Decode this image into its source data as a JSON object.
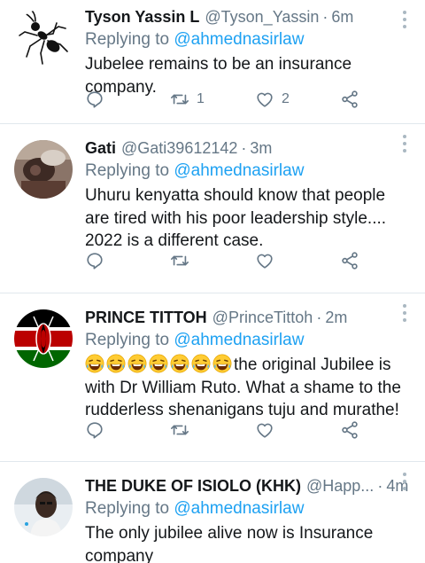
{
  "tweets": [
    {
      "name": "Tyson Yassin L",
      "handle": "@Tyson_Yassin",
      "time": "6m",
      "replying_prefix": "Replying to",
      "replying_to": "@ahmednasirlaw",
      "text": "Jubelee remains to be an insurance company.",
      "retweets": "1",
      "likes": "2",
      "avatar": "ant-icon"
    },
    {
      "name": "Gati",
      "handle": "@Gati39612142",
      "time": "3m",
      "replying_prefix": "Replying to",
      "replying_to": "@ahmednasirlaw",
      "text": "Uhuru kenyatta should know that people are tired with his poor leadership style.... 2022 is a different case.",
      "retweets": "",
      "likes": "",
      "avatar": "car-interior-photo"
    },
    {
      "name": "PRINCE TITTOH",
      "handle": "@PrinceTittoh",
      "time": "2m",
      "replying_prefix": "Replying to",
      "replying_to": "@ahmednasirlaw",
      "emoji_count": 7,
      "emoji": "laughing-face-emoji",
      "text": "the original Jubilee is with Dr William Ruto. What a shame to the rudderless shenanigans tuju and murathe!",
      "retweets": "",
      "likes": "",
      "avatar": "kenya-flag"
    },
    {
      "name": "THE DUKE OF ISIOLO (KHK)",
      "handle": "@Happ...",
      "time": "4m",
      "replying_prefix": "Replying to",
      "replying_to": "@ahmednasirlaw",
      "text": "The only jubilee alive now is Insurance company",
      "retweets": "",
      "likes": "",
      "avatar": "person-photo"
    }
  ],
  "colors": {
    "link": "#1da1f2",
    "secondary": "#657786",
    "divider": "#e1e8ed",
    "text": "#14171a"
  }
}
